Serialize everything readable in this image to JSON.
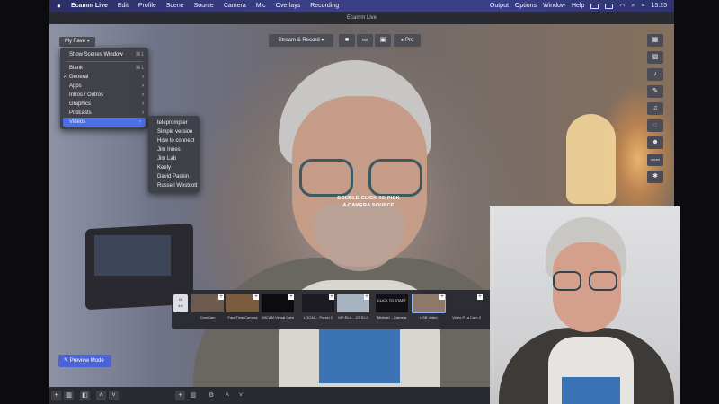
{
  "menubar": {
    "app_name": "Ecamm Live",
    "items": [
      "Edit",
      "Profile",
      "Scene",
      "Source",
      "Camera",
      "Mic",
      "Overlays",
      "Recording"
    ],
    "right_items": [
      "Output",
      "Options",
      "Window",
      "Help"
    ],
    "clock": "15:25",
    "accent": "#3a3f86"
  },
  "window": {
    "title": "Ecamm Live"
  },
  "toolbar": {
    "scene_label": "My Fave",
    "stream_label": "Stream & Record",
    "pro_label": "Pro"
  },
  "main_menu": {
    "show_scenes": "Show Scenes Window",
    "show_scenes_kbd": "⌘1",
    "items": [
      {
        "label": "Blank",
        "kbd": "⌘1",
        "chev": ""
      },
      {
        "label": "General",
        "kbd": "",
        "chev": "›",
        "check": "✓"
      },
      {
        "label": "Apps",
        "kbd": "",
        "chev": "›"
      },
      {
        "label": "Intros / Outros",
        "kbd": "",
        "chev": "›"
      },
      {
        "label": "Graphics",
        "kbd": "",
        "chev": "›"
      },
      {
        "label": "Podcasts",
        "kbd": "",
        "chev": "›"
      },
      {
        "label": "Videos",
        "kbd": "",
        "chev": "›"
      }
    ]
  },
  "sub_menu": {
    "items": [
      "teleprompter",
      "Simple version",
      "How to connect",
      "Jim Innes",
      "Jim Lab",
      "Keely",
      "David Paskin",
      "Russell Westcott"
    ]
  },
  "camera": {
    "hint_line1": "DOUBLE-CLICK TO PICK",
    "hint_line2": "A CAMERA SOURCE"
  },
  "strip": {
    "side_label_top": "4K",
    "side_label_bottom": "4/8",
    "items": [
      {
        "label": "CamCam",
        "color": "#6b5a4d"
      },
      {
        "label": "FaceTime Camera",
        "color": "#7a5c3f"
      },
      {
        "label": "WICAM Virtual Cam",
        "color": "#0c0c0f"
      },
      {
        "label": "LOCAL... Ponch 2",
        "color": "#1c1c22"
      },
      {
        "label": "MP-RLA ...CRS1.0",
        "color": "#a8b3c2"
      },
      {
        "label": "Michael ...Camera",
        "color": "#111115"
      },
      {
        "label": "USB Video",
        "color": "#8e7a6a"
      },
      {
        "label": "Video P...a Cam 2",
        "color": "#2c2c34"
      }
    ],
    "click_to_start": "CLICK TO START"
  },
  "preview": {
    "label": "Preview Mode"
  },
  "rail": {
    "items": [
      "layout-icon",
      "image-icon",
      "microphone-icon",
      "magic-wand-icon",
      "music-icon",
      "chat-icon",
      "people-icon",
      "zoom-icon",
      "gear-icon"
    ],
    "zoom_text": "zoom"
  }
}
